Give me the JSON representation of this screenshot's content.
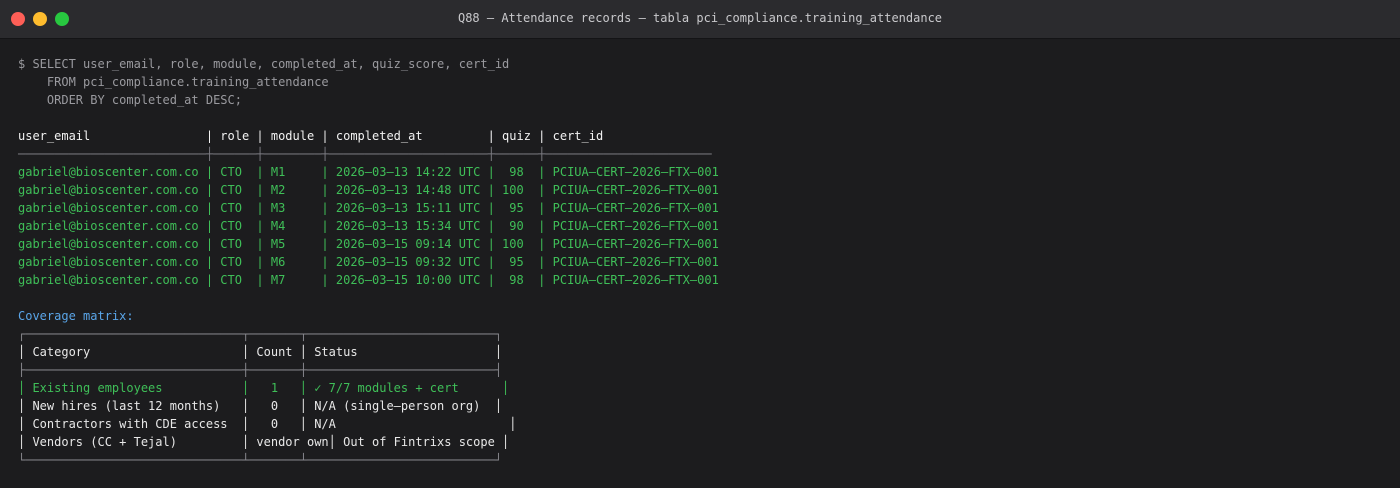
{
  "window": {
    "title": "Q88 — Attendance records — tabla pci_compliance.training_attendance"
  },
  "terminal": {
    "command_lines": [
      "$ SELECT user_email, role, module, completed_at, quiz_score, cert_id",
      "    FROM pci_compliance.training_attendance",
      "    ORDER BY completed_at DESC;"
    ],
    "table_header": "user_email                | role | module | completed_at         | quiz | cert_id",
    "table_separator": "──────────────────────────┼──────┼────────┼──────────────────────┼──────┼───────────────────────",
    "rows": [
      "gabriel@bioscenter.com.co | CTO  | M1     | 2026–03–13 14:22 UTC |  98  | PCIUA–CERT–2026–FTX–001",
      "gabriel@bioscenter.com.co | CTO  | M2     | 2026–03–13 14:48 UTC | 100  | PCIUA–CERT–2026–FTX–001",
      "gabriel@bioscenter.com.co | CTO  | M3     | 2026–03–13 15:11 UTC |  95  | PCIUA–CERT–2026–FTX–001",
      "gabriel@bioscenter.com.co | CTO  | M4     | 2026–03–13 15:34 UTC |  90  | PCIUA–CERT–2026–FTX–001",
      "gabriel@bioscenter.com.co | CTO  | M5     | 2026–03–15 09:14 UTC | 100  | PCIUA–CERT–2026–FTX–001",
      "gabriel@bioscenter.com.co | CTO  | M6     | 2026–03–15 09:32 UTC |  95  | PCIUA–CERT–2026–FTX–001",
      "gabriel@bioscenter.com.co | CTO  | M7     | 2026–03–15 10:00 UTC |  98  | PCIUA–CERT–2026–FTX–001"
    ],
    "coverage_label": "Coverage matrix:",
    "matrix": {
      "top_border": "┌──────────────────────────────┬───────┬──────────────────────────┐",
      "header_row": "│ Category                     │ Count │ Status                   │",
      "header_sep": "├──────────────────────────────┼───────┼──────────────────────────┤",
      "rows": [
        "│ Existing employees           │   1   │ ✓ 7/7 modules + cert      │",
        "│ New hires (last 12 months)   │   0   │ N/A (single–person org)  │",
        "│ Contractors with CDE access  │   0   │ N/A                        │",
        "│ Vendors (CC + Tejal)         │ vendor own│ Out of Fintrixs scope │"
      ],
      "bottom_border": "└──────────────────────────────┴───────┴──────────────────────────┘"
    }
  },
  "colors": {
    "background": "#1c1c1e",
    "titlebar": "#2b2b2e",
    "green": "#3fbf58",
    "blue": "#5aa5e8",
    "close": "#fe5f57",
    "minimize": "#febc2e",
    "maximize": "#28c840"
  }
}
